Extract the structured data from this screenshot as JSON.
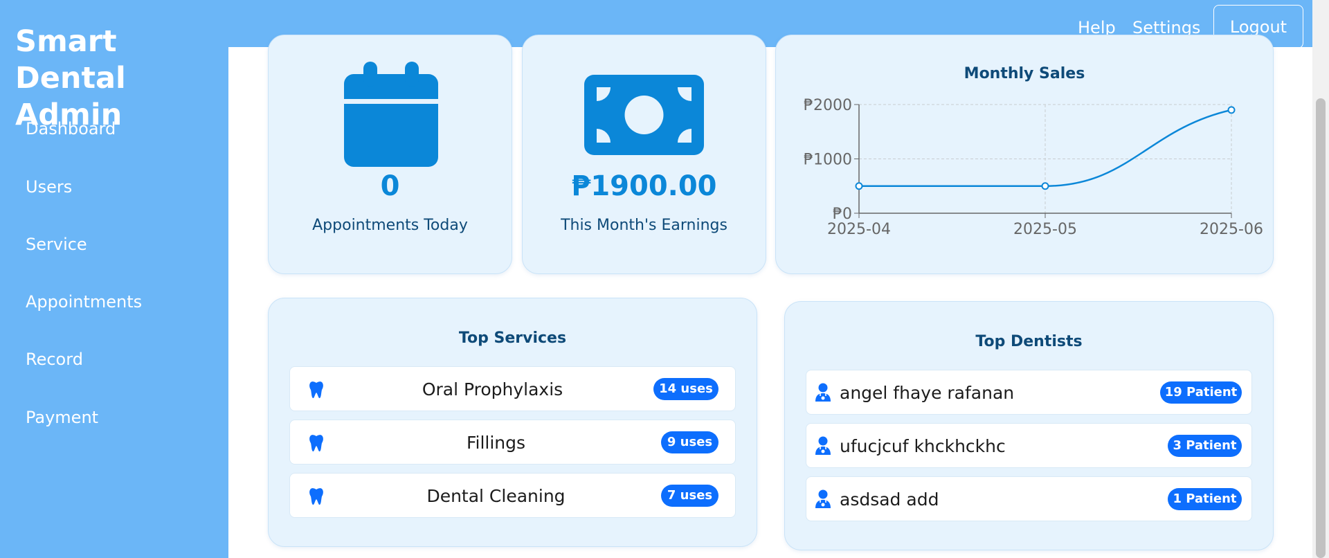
{
  "sidebar": {
    "brand": "Smart Dental Admin",
    "items": [
      {
        "label": "Dashboard"
      },
      {
        "label": "Users"
      },
      {
        "label": "Service"
      },
      {
        "label": "Appointments"
      },
      {
        "label": "Record"
      },
      {
        "label": "Payment"
      }
    ]
  },
  "topbar": {
    "help_label": "Help",
    "settings_label": "Settings",
    "logout_label": "Logout"
  },
  "stats": {
    "appointments": {
      "value": "0",
      "label": "Appointments Today",
      "icon": "calendar-icon"
    },
    "earnings": {
      "value": "₱1900.00",
      "label": "This Month's Earnings",
      "icon": "money-bill-icon"
    }
  },
  "chart_data": {
    "type": "line",
    "title": "Monthly Sales",
    "categories": [
      "2025-04",
      "2025-05",
      "2025-06"
    ],
    "series": [
      {
        "values": [
          500,
          500,
          1900
        ]
      }
    ],
    "ylim": [
      0,
      2000
    ],
    "yticks": [
      "₱0",
      "₱1000",
      "₱2000"
    ],
    "grid": true,
    "color": "#0b87d8"
  },
  "top_services": {
    "title": "Top Services",
    "items": [
      {
        "name": "Oral Prophylaxis",
        "badge": "14 uses"
      },
      {
        "name": "Fillings",
        "badge": "9 uses"
      },
      {
        "name": "Dental Cleaning",
        "badge": "7 uses"
      }
    ]
  },
  "top_dentists": {
    "title": "Top Dentists",
    "items": [
      {
        "name": "angel fhaye rafanan",
        "badge": "19 Patient"
      },
      {
        "name": "ufucjcuf khckhckhc",
        "badge": "3 Patient"
      },
      {
        "name": "asdsad add",
        "badge": "1 Patient"
      }
    ]
  },
  "colors": {
    "sidebar": "#6bb6f7",
    "card_bg": "#e6f3fd",
    "accent": "#0b87d8",
    "badge": "#0d6efd",
    "heading": "#0e4a78"
  }
}
